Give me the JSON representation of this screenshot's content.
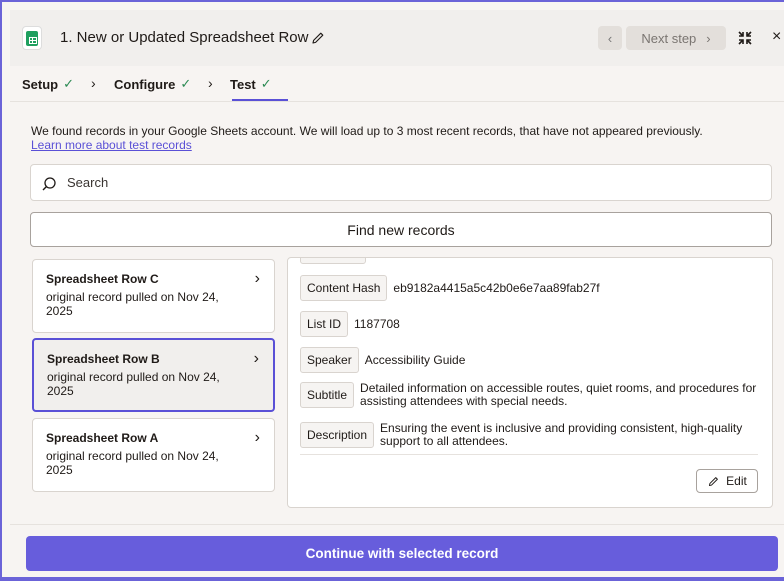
{
  "header": {
    "title": "1. New or Updated Spreadsheet Row",
    "next_step_label": "Next step",
    "prev_glyph": "‹",
    "next_glyph": "›",
    "close_glyph": "×"
  },
  "tabs": [
    {
      "label": "Setup",
      "done": true
    },
    {
      "label": "Configure",
      "done": true
    },
    {
      "label": "Test",
      "done": true,
      "active": true
    }
  ],
  "tab_check_glyph": "✓",
  "tab_separator_glyph": "›",
  "intro": {
    "text": "We found records in your Google Sheets account. We will load up to 3 most recent records, that have not appeared previously.",
    "link_text": "Learn more about test records"
  },
  "search": {
    "placeholder": "Search",
    "value": ""
  },
  "find_button_label": "Find new records",
  "records": [
    {
      "title": "Spreadsheet Row C",
      "subtitle": "original record pulled on Nov 24, 2025",
      "selected": false
    },
    {
      "title": "Spreadsheet Row B",
      "subtitle": "original record pulled on Nov 24, 2025",
      "selected": true
    },
    {
      "title": "Spreadsheet Row A",
      "subtitle": "original record pulled on Nov 24, 2025",
      "selected": false
    }
  ],
  "record_chevron_glyph": "›",
  "details": {
    "fields": [
      {
        "key": "Content Hash",
        "value": "eb9182a4415a5c42b0e6e7aa89fab27f"
      },
      {
        "key": "List ID",
        "value": "1187708"
      },
      {
        "key": "Speaker",
        "value": "Accessibility Guide"
      },
      {
        "key": "Subtitle",
        "value": "Detailed information on accessible routes, quiet rooms, and procedures for assisting attendees with special needs."
      },
      {
        "key": "Description",
        "value": "Ensuring the event is inclusive and providing consistent, high-quality support to all attendees."
      }
    ],
    "edit_label": "Edit"
  },
  "continue_button_label": "Continue with selected record",
  "colors": {
    "accent": "#5a50d6",
    "primary_button": "#675ddc",
    "check": "#2b8a53",
    "sheets_green": "#1e9f5e"
  },
  "icons": [
    "google-sheets-icon",
    "pencil-icon",
    "chevron-left-icon",
    "chevron-right-icon",
    "collapse-icon",
    "close-icon",
    "check-icon",
    "search-icon",
    "edit-pencil-icon"
  ]
}
